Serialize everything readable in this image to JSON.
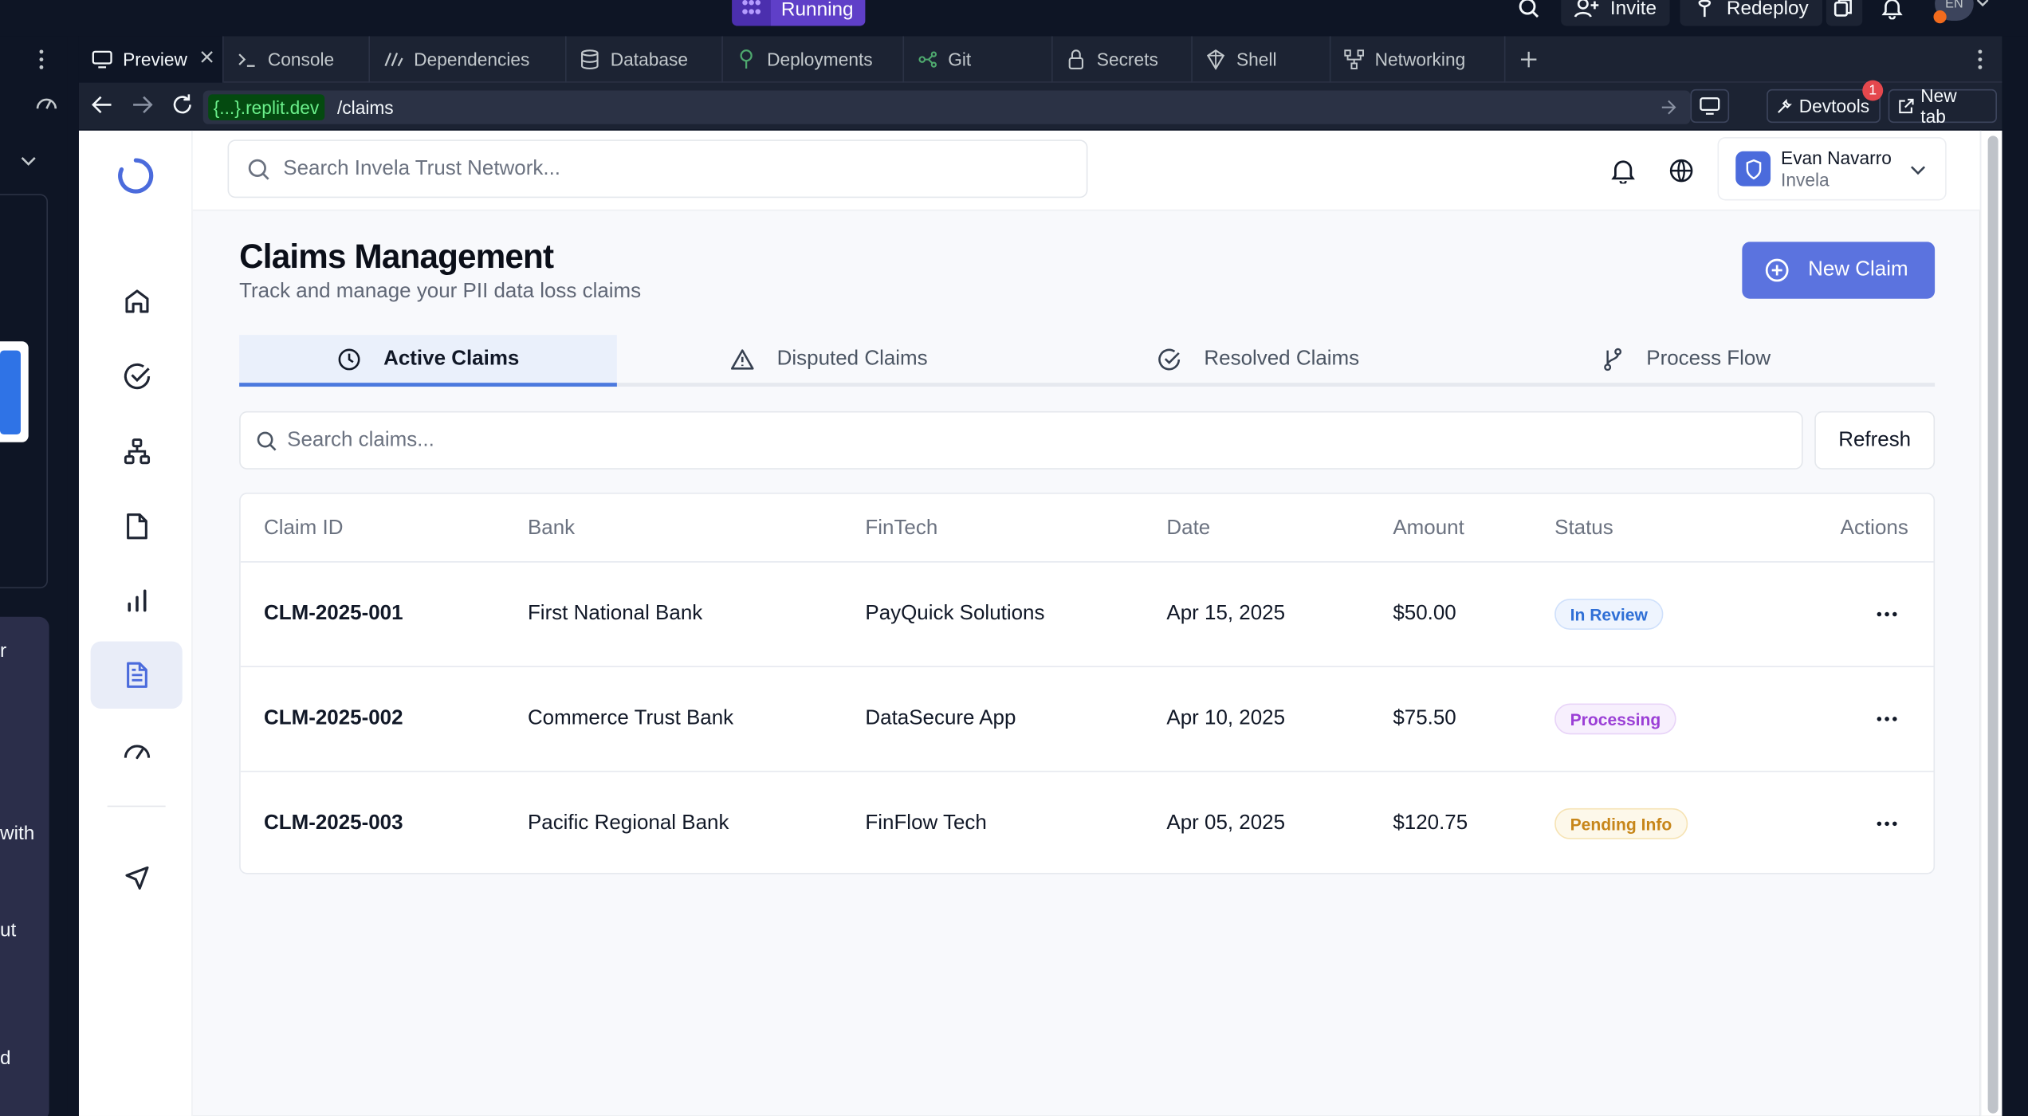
{
  "topbar": {
    "run_label": "Running",
    "invite_label": "Invite",
    "redeploy_label": "Redeploy",
    "lang_badge": "EN"
  },
  "workspace_tabs": [
    {
      "label": "Preview",
      "icon": "monitor-icon"
    },
    {
      "label": "Console",
      "icon": "terminal-icon"
    },
    {
      "label": "Dependencies",
      "icon": "dependencies-icon"
    },
    {
      "label": "Database",
      "icon": "database-icon"
    },
    {
      "label": "Deployments",
      "icon": "deploy-icon"
    },
    {
      "label": "Git",
      "icon": "git-icon"
    },
    {
      "label": "Secrets",
      "icon": "lock-icon"
    },
    {
      "label": "Shell",
      "icon": "shell-icon"
    },
    {
      "label": "Networking",
      "icon": "network-icon"
    }
  ],
  "urlbar": {
    "host": "{...}.replit.dev",
    "path": "/claims",
    "devtools_label": "Devtools",
    "devtools_count": "1",
    "newtab_label": "New tab"
  },
  "left_panel_fragments": [
    "r",
    "with",
    "ut",
    "d"
  ],
  "app": {
    "search_placeholder": "Search Invela Trust Network...",
    "user": {
      "name": "Evan Navarro",
      "org": "Invela"
    },
    "page_title": "Claims Management",
    "page_subtitle": "Track and manage your PII data loss claims",
    "new_claim_label": "New Claim",
    "tabs": [
      {
        "label": "Active Claims",
        "icon": "clock-icon",
        "active": true
      },
      {
        "label": "Disputed Claims",
        "icon": "warning-icon",
        "active": false
      },
      {
        "label": "Resolved Claims",
        "icon": "check-circle-icon",
        "active": false
      },
      {
        "label": "Process Flow",
        "icon": "branch-icon",
        "active": false
      }
    ],
    "claims_search_placeholder": "Search claims...",
    "refresh_label": "Refresh",
    "table": {
      "headers": [
        "Claim ID",
        "Bank",
        "FinTech",
        "Date",
        "Amount",
        "Status",
        "Actions"
      ],
      "rows": [
        {
          "id": "CLM-2025-001",
          "bank": "First National Bank",
          "fintech": "PayQuick Solutions",
          "date": "Apr 15, 2025",
          "amount": "$50.00",
          "status": "In Review"
        },
        {
          "id": "CLM-2025-002",
          "bank": "Commerce Trust Bank",
          "fintech": "DataSecure App",
          "date": "Apr 10, 2025",
          "amount": "$75.50",
          "status": "Processing"
        },
        {
          "id": "CLM-2025-003",
          "bank": "Pacific Regional Bank",
          "fintech": "FinFlow Tech",
          "date": "Apr 05, 2025",
          "amount": "$120.75",
          "status": "Pending Info"
        }
      ]
    }
  },
  "colors": {
    "replit_bg": "#0e1525",
    "accent": "#5b73df",
    "run": "#5f3fc8",
    "status_in_review": "#2f6fd6",
    "status_processing": "#9b3fd6",
    "status_pending": "#c7861a"
  }
}
